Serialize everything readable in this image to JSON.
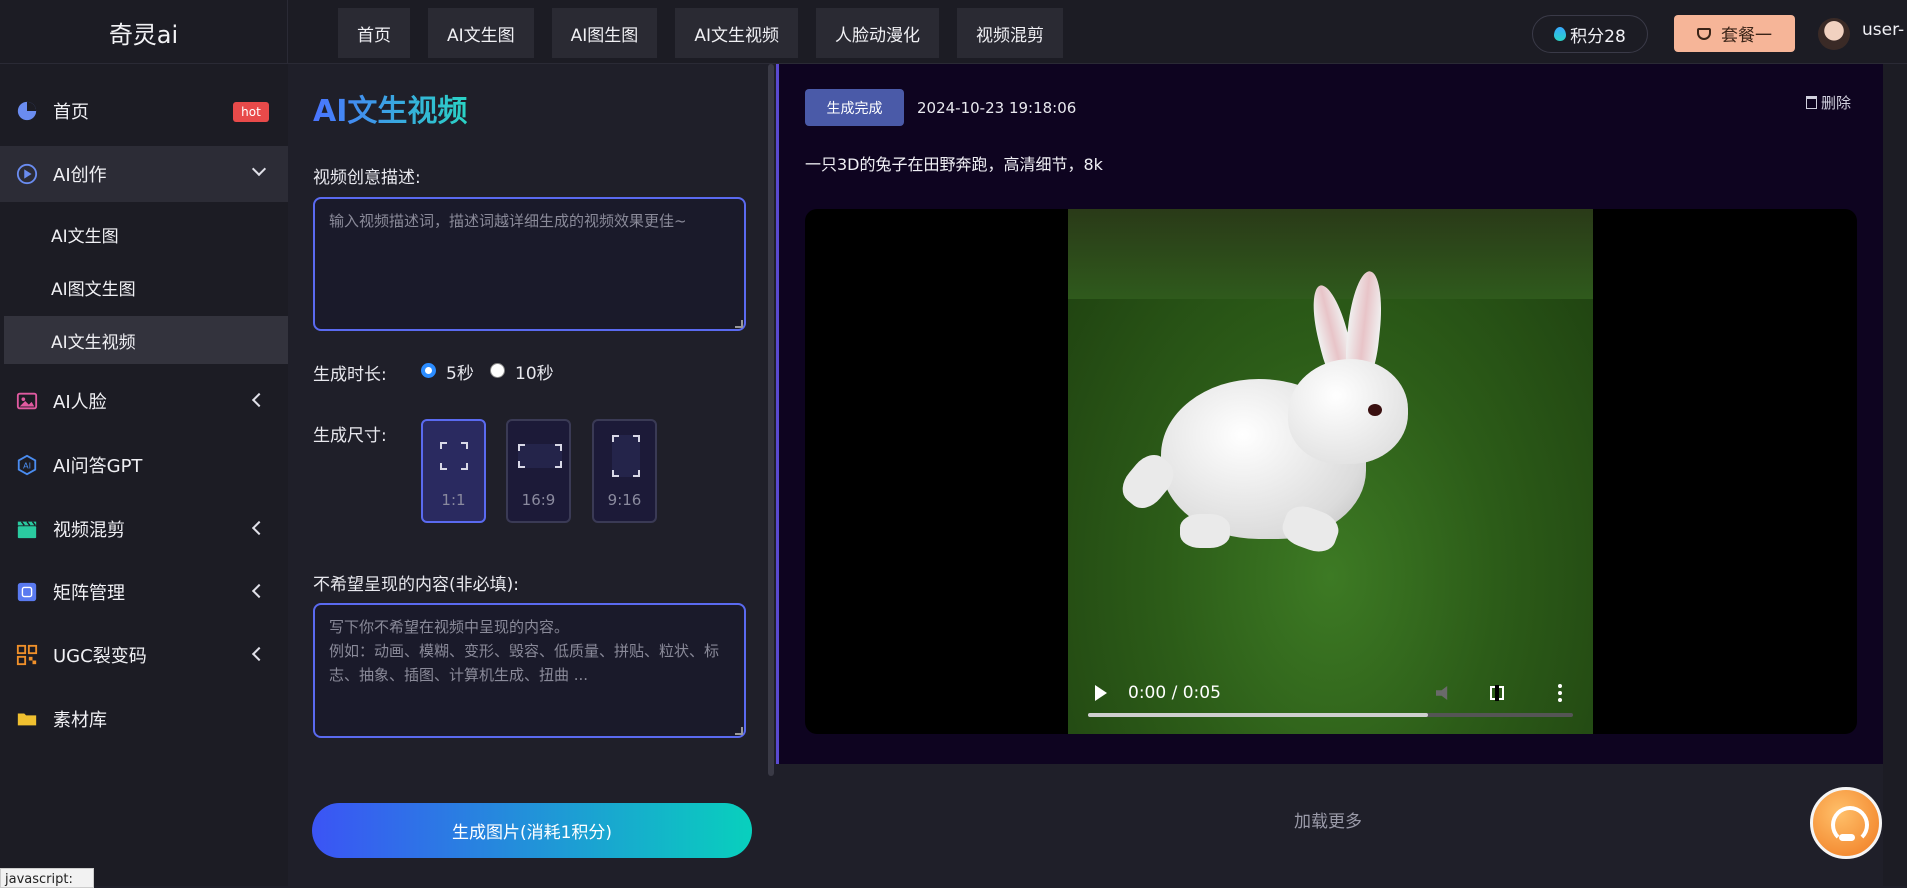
{
  "app": {
    "logo": "奇灵ai",
    "username": "user-"
  },
  "nav": {
    "tabs": [
      "首页",
      "AI文生图",
      "AI图生图",
      "AI文生视频",
      "人脸动漫化",
      "视频混剪"
    ]
  },
  "account": {
    "points": "积分28",
    "plan": "套餐一"
  },
  "sidebar": {
    "home": "首页",
    "hot": "hot",
    "ai_create": "AI创作",
    "sub": [
      "AI文生图",
      "AI图文生图",
      "AI文生视频"
    ],
    "ai_face": "AI人脸",
    "ai_gpt": "AI问答GPT",
    "video_mix": "视频混剪",
    "matrix": "矩阵管理",
    "ugc": "UGC裂变码",
    "library": "素材库"
  },
  "form": {
    "title": "AI文生视频",
    "desc_label": "视频创意描述:",
    "desc_placeholder": "输入视频描述词，描述词越详细生成的视频效果更佳~",
    "duration_label": "生成时长:",
    "duration_options": [
      "5秒",
      "10秒"
    ],
    "duration_selected": "5秒",
    "size_label": "生成尺寸:",
    "size_options": [
      "1:1",
      "16:9",
      "9:16"
    ],
    "size_selected": "1:1",
    "negative_label": "不希望呈现的内容(非必填):",
    "negative_placeholder": "写下你不希望在视频中呈现的内容。\n例如：动画、模糊、变形、毁容、低质量、拼贴、粒状、标志、抽象、插图、计算机生成、扭曲 ...",
    "generate_button": "生成图片(消耗1积分)"
  },
  "result": {
    "status": "生成完成",
    "timestamp": "2024-10-23 19:18:06",
    "delete": "删除",
    "prompt": "一只3D的兔子在田野奔跑，高清细节，8k",
    "video_time": "0:00 / 0:05",
    "video_progress": 0.7,
    "load_more": "加载更多"
  },
  "status_bar": "javascript:",
  "colors": {
    "accent": "#5a6af0",
    "hot": "#e84a4a",
    "plan": "#f6b598",
    "status": "#4a5aa8"
  }
}
